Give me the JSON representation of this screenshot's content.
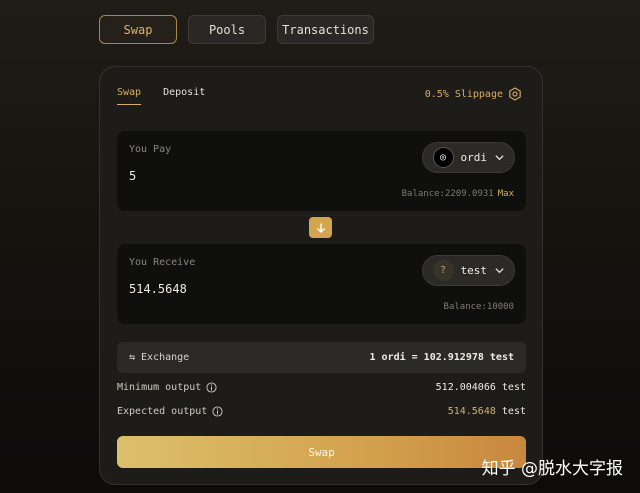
{
  "nav": {
    "tabs": [
      {
        "label": "Swap"
      },
      {
        "label": "Pools"
      },
      {
        "label": "Transactions"
      }
    ]
  },
  "card": {
    "tabs": [
      {
        "label": "Swap"
      },
      {
        "label": "Deposit"
      }
    ],
    "slippage": "0.5% Slippage",
    "pay": {
      "label": "You Pay",
      "amount": "5",
      "token": "ordi",
      "balance": "Balance:2209.0931",
      "max": "Max"
    },
    "receive": {
      "label": "You Receive",
      "amount": "514.5648",
      "token": "test",
      "balance": "Balance:10000"
    },
    "exchange": {
      "label": "Exchange",
      "rate": "1 ordi = 102.912978 test"
    },
    "minimum_output": {
      "label": "Minimum output",
      "value": "512.004066",
      "unit": "test"
    },
    "expected_output": {
      "label": "Expected output",
      "value": "514.5648",
      "unit": "test"
    },
    "swap_button": "Swap"
  },
  "watermark": "知乎 @脱水大字报",
  "colors": {
    "accent": "#d9ae64",
    "button_gradient_start": "#dcc06b",
    "button_gradient_end": "#c8873e"
  },
  "icons": [
    "settings-icon",
    "chevron-down-icon",
    "arrow-down-icon",
    "exchange-icon",
    "info-icon",
    "ordi-token-icon",
    "test-token-icon"
  ]
}
